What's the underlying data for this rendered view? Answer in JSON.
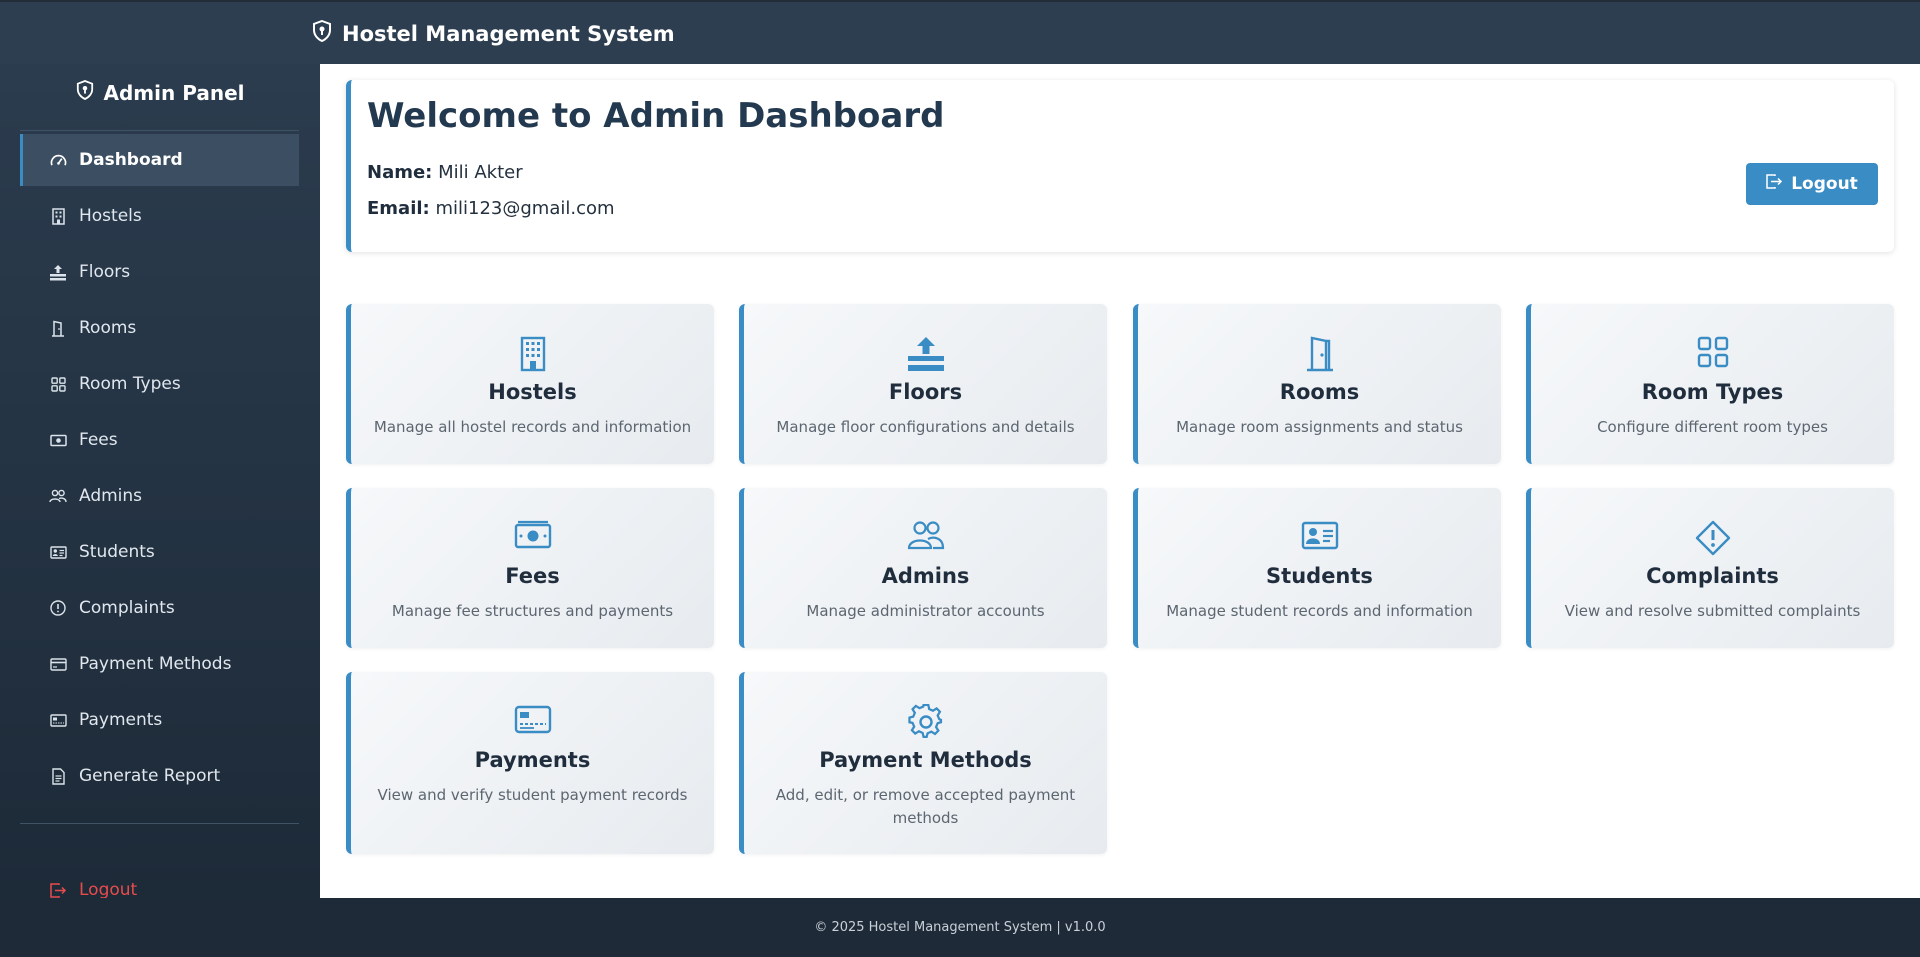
{
  "header": {
    "title": "Hostel Management System",
    "icon": "shield-icon"
  },
  "sidebar": {
    "title": "Admin Panel",
    "items": [
      {
        "label": "Dashboard",
        "icon": "speedometer-icon",
        "active": true
      },
      {
        "label": "Hostels",
        "icon": "building-icon"
      },
      {
        "label": "Floors",
        "icon": "floors-icon"
      },
      {
        "label": "Rooms",
        "icon": "door-icon"
      },
      {
        "label": "Room Types",
        "icon": "grid-icon"
      },
      {
        "label": "Fees",
        "icon": "cash-icon"
      },
      {
        "label": "Admins",
        "icon": "people-icon"
      },
      {
        "label": "Students",
        "icon": "id-card-icon"
      },
      {
        "label": "Complaints",
        "icon": "exclamation-icon"
      },
      {
        "label": "Payment Methods",
        "icon": "credit-card-icon"
      },
      {
        "label": "Payments",
        "icon": "receipt-icon"
      },
      {
        "label": "Generate Report",
        "icon": "document-icon"
      }
    ],
    "logout": "Logout"
  },
  "welcome": {
    "title": "Welcome to Admin Dashboard",
    "name_label": "Name:",
    "name_value": "Mili Akter",
    "email_label": "Email:",
    "email_value": "mili123@gmail.com",
    "logout_label": "Logout"
  },
  "cards": [
    {
      "title": "Hostels",
      "desc": "Manage all hostel records and information",
      "icon": "building-icon"
    },
    {
      "title": "Floors",
      "desc": "Manage floor configurations and details",
      "icon": "floors-icon"
    },
    {
      "title": "Rooms",
      "desc": "Manage room assignments and status",
      "icon": "door-icon"
    },
    {
      "title": "Room Types",
      "desc": "Configure different room types",
      "icon": "grid-icon"
    },
    {
      "title": "Fees",
      "desc": "Manage fee structures and payments",
      "icon": "cash-icon"
    },
    {
      "title": "Admins",
      "desc": "Manage administrator accounts",
      "icon": "people-icon"
    },
    {
      "title": "Students",
      "desc": "Manage student records and information",
      "icon": "id-card-icon"
    },
    {
      "title": "Complaints",
      "desc": "View and resolve submitted complaints",
      "icon": "exclamation-diamond-icon"
    },
    {
      "title": "Payments",
      "desc": "View and verify student payment records",
      "icon": "credit-card-icon"
    },
    {
      "title": "Payment Methods",
      "desc": "Add, edit, or remove accepted payment methods",
      "icon": "gear-icon"
    }
  ],
  "footer": {
    "text": "© 2025 Hostel Management System | v1.0.0"
  },
  "colors": {
    "accent": "#3a8cc4",
    "sidebar": "#2b3c4e",
    "topbar": "#2d3e50",
    "footer": "#1f2a38",
    "logout_red": "#e74c4c"
  }
}
